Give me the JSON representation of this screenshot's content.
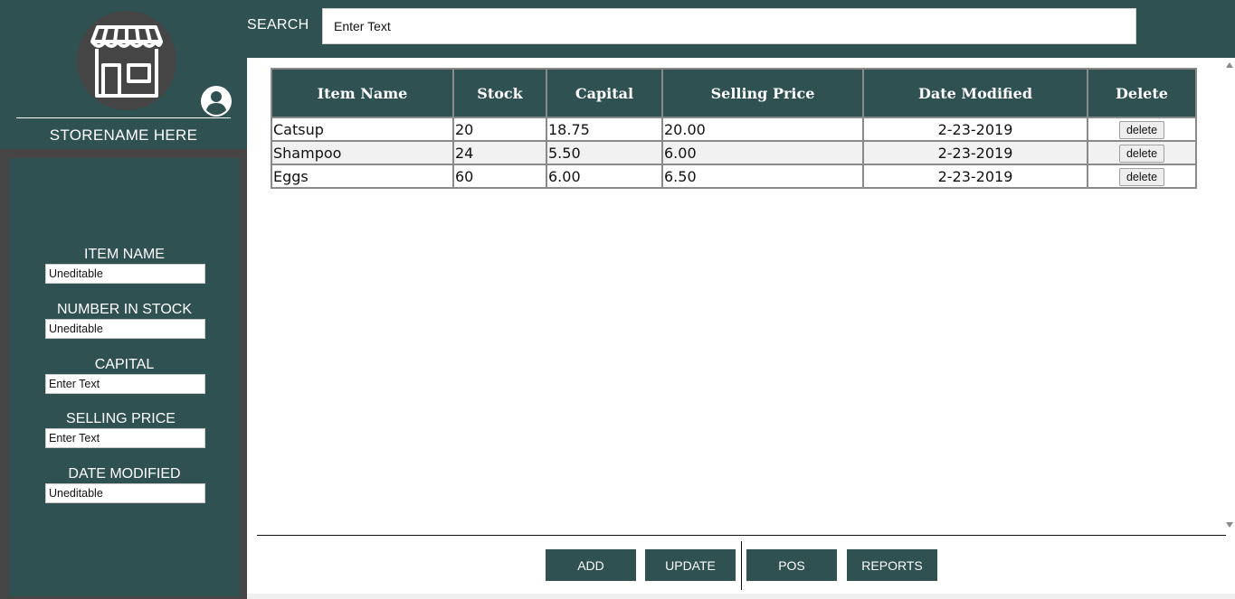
{
  "sidebar": {
    "store_name": "STORENAME HERE",
    "logo_icon": "storefront-icon",
    "user_icon": "user-circle-icon",
    "fields": [
      {
        "label": "ITEM NAME",
        "value": "Uneditable"
      },
      {
        "label": "NUMBER IN STOCK",
        "value": "Uneditable"
      },
      {
        "label": "CAPITAL",
        "value": "Enter Text"
      },
      {
        "label": "SELLING PRICE",
        "value": "Enter Text"
      },
      {
        "label": "DATE MODIFIED",
        "value": "Uneditable"
      }
    ]
  },
  "search": {
    "label": "SEARCH",
    "value": "Enter Text"
  },
  "table": {
    "headers": [
      "Item Name",
      "Stock",
      "Capital",
      "Selling Price",
      "Date Modified",
      "Delete"
    ],
    "rows": [
      {
        "item": "Catsup",
        "stock": "20",
        "capital": "18.75",
        "price": "20.00",
        "date": "2-23-2019",
        "action": "delete"
      },
      {
        "item": "Shampoo",
        "stock": "24",
        "capital": "5.50",
        "price": "6.00",
        "date": "2-23-2019",
        "action": "delete"
      },
      {
        "item": "Eggs",
        "stock": "60",
        "capital": "6.00",
        "price": "6.50",
        "date": "2-23-2019",
        "action": "delete"
      }
    ]
  },
  "actions": {
    "add": "ADD",
    "update": "UPDATE",
    "pos": "POS",
    "reports": "REPORTS"
  },
  "colors": {
    "primary": "#2f5152",
    "frame": "#454545",
    "border": "#8a8a8a"
  }
}
